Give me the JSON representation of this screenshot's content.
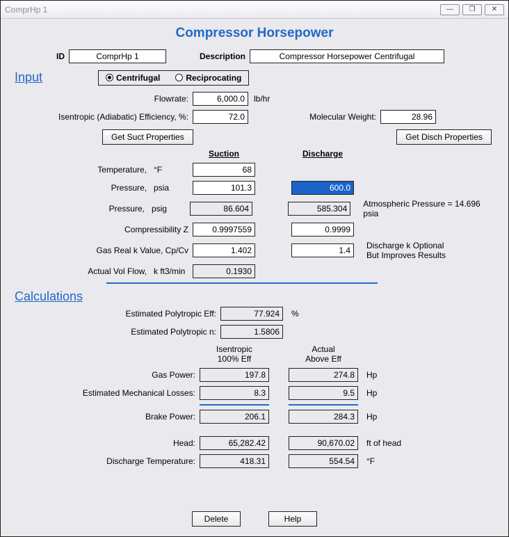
{
  "window": {
    "title": "ComprHp 1"
  },
  "title": "Compressor Horsepower",
  "id_label": "ID",
  "id_value": "ComprHp 1",
  "desc_label": "Description",
  "desc_value": "Compressor Horsepower Centrifugal",
  "input_section": "Input",
  "radio": {
    "centrifugal": "Centrifugal",
    "reciprocating": "Reciprocating"
  },
  "labels": {
    "flowrate": "Flowrate:",
    "flowrate_unit": "lb/hr",
    "iso_eff": "Isentropic (Adiabatic) Efficiency, %:",
    "mol_wt": "Molecular Weight:",
    "get_suct": "Get Suct Properties",
    "get_disch": "Get Disch Properties",
    "suction": "Suction",
    "discharge": "Discharge",
    "temp": "Temperature,",
    "temp_unit": "°F",
    "press_psia": "Pressure,",
    "psia": "psia",
    "press_psig": "Pressure,",
    "psig": "psig",
    "compress_z": "Compressibility Z",
    "gas_k": "Gas Real k Value, Cp/Cv",
    "avf": "Actual Vol Flow,",
    "avf_unit": "k ft3/min",
    "atm": "Atmospheric Pressure = 14.696 psia",
    "disch_k1": "Discharge k Optional",
    "disch_k2": "But Improves Results"
  },
  "values": {
    "flowrate": "6,000.0",
    "iso_eff": "72.0",
    "mol_wt": "28.96",
    "suct_temp": "68",
    "suct_psia": "101.3",
    "suct_psig": "86.604",
    "suct_z": "0.9997559",
    "suct_k": "1.402",
    "avf": "0.1930",
    "disch_psia": "600.0",
    "disch_psig": "585.304",
    "disch_z": "0.9999",
    "disch_k": "1.4"
  },
  "calc_section": "Calculations",
  "calc": {
    "labels": {
      "poly_eff": "Estimated Polytropic Eff:",
      "poly_n": "Estimated Polytropic n:",
      "col_isen1": "Isentropic",
      "col_isen2": "100% Eff",
      "col_act1": "Actual",
      "col_act2": "Above Eff",
      "gas_power": "Gas Power:",
      "mech_loss": "Estimated Mechanical Losses:",
      "brake": "Brake Power:",
      "head": "Head:",
      "disch_t": "Discharge Temperature:",
      "hp": "Hp",
      "fthead": "ft of head",
      "degF": "°F",
      "pct": "%"
    },
    "values": {
      "poly_eff": "77.924",
      "poly_n": "1.5806",
      "gas_p_isen": "197.8",
      "gas_p_act": "274.8",
      "mech_isen": "8.3",
      "mech_act": "9.5",
      "brake_isen": "206.1",
      "brake_act": "284.3",
      "head_isen": "65,282.42",
      "head_act": "90,670.02",
      "dt_isen": "418.31",
      "dt_act": "554.54"
    }
  },
  "buttons": {
    "delete": "Delete",
    "help": "Help"
  }
}
